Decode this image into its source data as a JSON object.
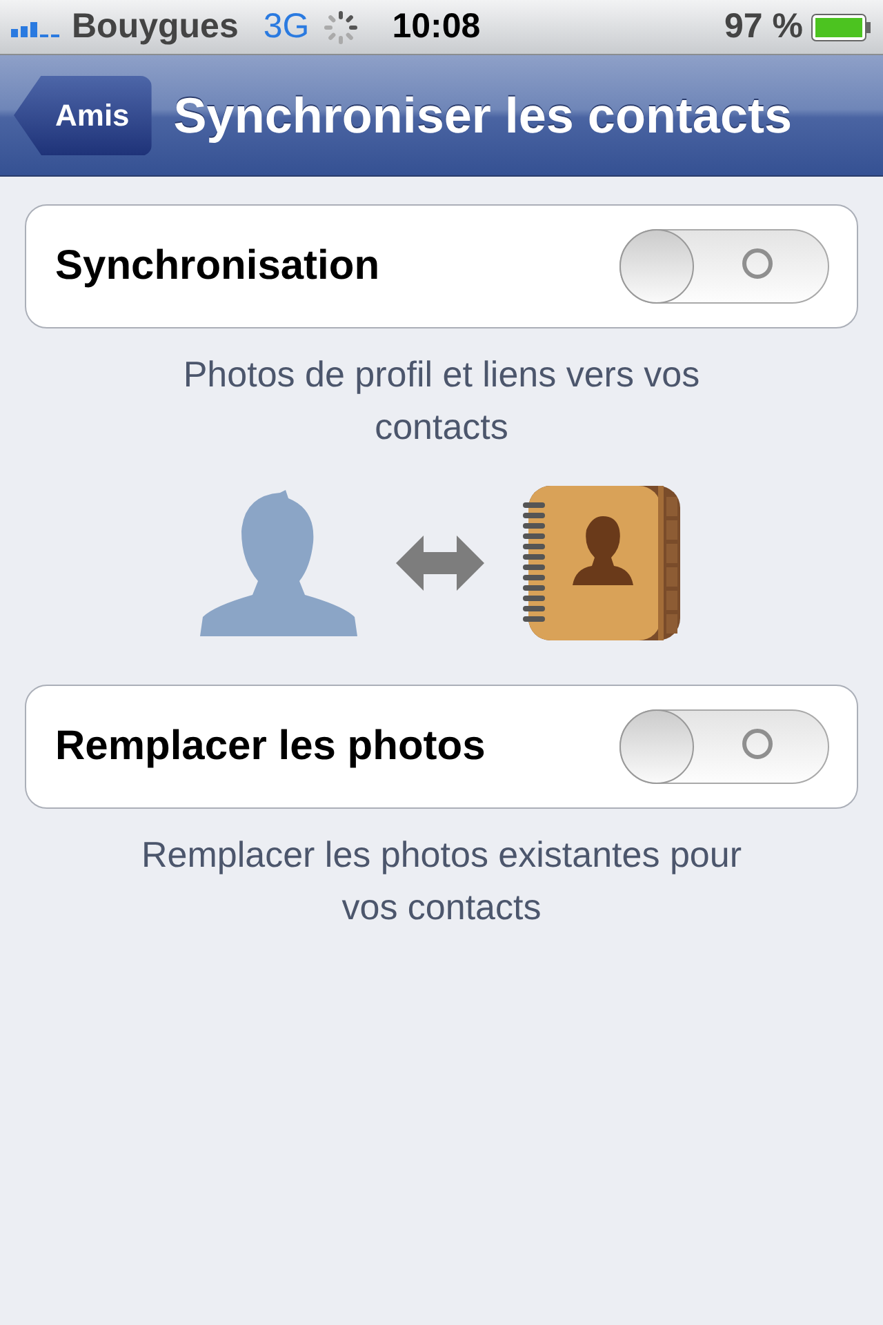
{
  "status_bar": {
    "carrier": "Bouygues",
    "network": "3G",
    "time": "10:08",
    "battery": "97 %"
  },
  "nav_bar": {
    "back": "Amis",
    "title": "Synchroniser les contacts"
  },
  "items": [
    {
      "kind": "setting",
      "label": "Synchronisation",
      "on": false
    },
    {
      "kind": "note",
      "text": "Photos de profil et liens vers vos contacts"
    },
    {
      "kind": "illustration"
    },
    {
      "kind": "setting",
      "label": "Remplacer les photos",
      "on": false
    },
    {
      "kind": "note",
      "text": "Remplacer les photos existantes pour vos contacts"
    }
  ]
}
